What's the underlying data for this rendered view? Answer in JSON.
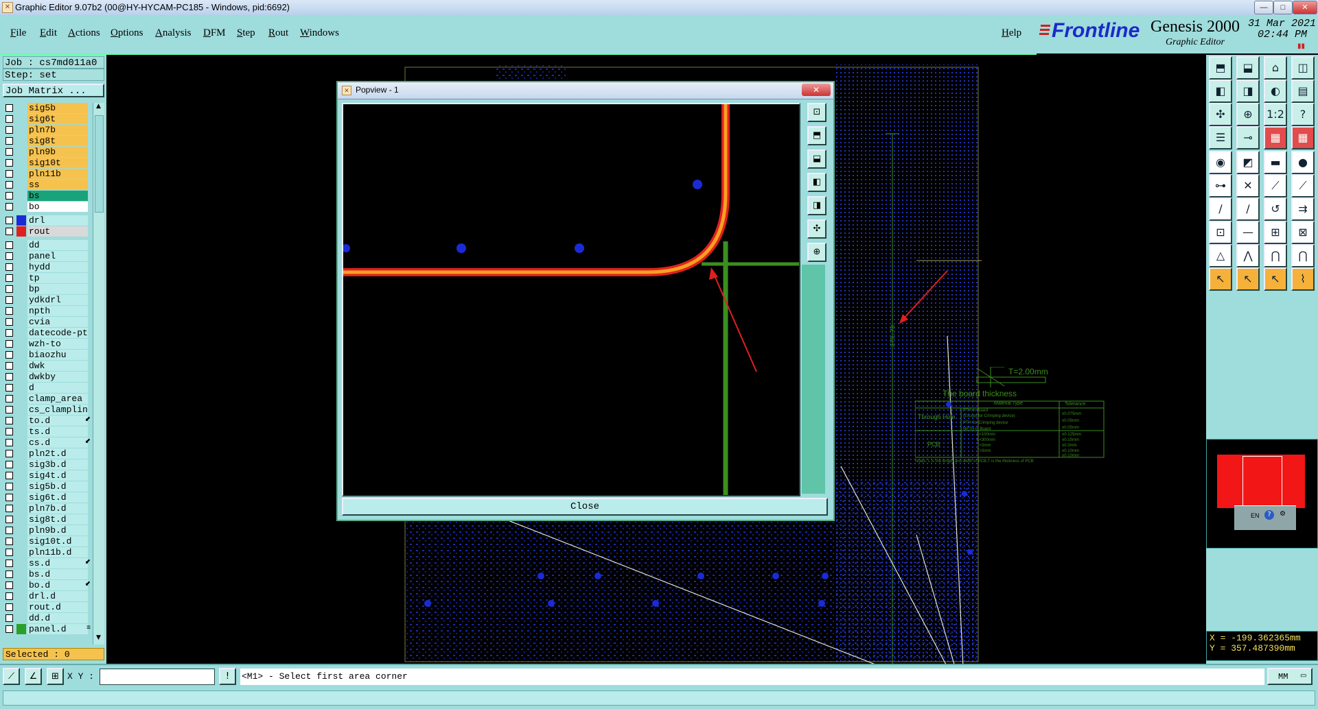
{
  "titlebar": {
    "title": "Graphic Editor 9.07b2 (00@HY-HYCAM-PC185 - Windows, pid:6692)"
  },
  "menu": {
    "items": [
      "File",
      "Edit",
      "Actions",
      "Options",
      "Analysis",
      "DFM",
      "Step",
      "Rout",
      "Windows"
    ],
    "help": "Help"
  },
  "brand": {
    "logo": "Frontline",
    "product": "Genesis 2000",
    "subtitle": "Graphic Editor",
    "date": "31 Mar 2021",
    "time": "02:44 PM"
  },
  "job": {
    "job_label": "Job : cs7md011a0",
    "step_label": "Step: set",
    "matrix_button": "Job Matrix ..."
  },
  "layers": [
    {
      "name": "sig5b",
      "color": "#f6c24e"
    },
    {
      "name": "sig6t",
      "color": "#f6c24e"
    },
    {
      "name": "pln7b",
      "color": "#f6c24e"
    },
    {
      "name": "sig8t",
      "color": "#f6c24e"
    },
    {
      "name": "pln9b",
      "color": "#f6c24e"
    },
    {
      "name": "sig10t",
      "color": "#f6c24e"
    },
    {
      "name": "pln11b",
      "color": "#f6c24e"
    },
    {
      "name": "ss",
      "color": "#f6c24e"
    },
    {
      "name": "bs",
      "color": "#19a37a"
    },
    {
      "name": "bo",
      "color": "#ffffff"
    },
    {
      "name": "drl",
      "color": "#b9ecea",
      "swatch": "#1a2bd6"
    },
    {
      "name": "rout",
      "color": "#d9d9d9",
      "swatch": "#e02020"
    },
    {
      "name": "dd",
      "color": "#b9ecea"
    },
    {
      "name": "panel",
      "color": "#b9ecea"
    },
    {
      "name": "hydd",
      "color": "#b9ecea"
    },
    {
      "name": "tp",
      "color": "#b9ecea"
    },
    {
      "name": "bp",
      "color": "#b9ecea"
    },
    {
      "name": "ydkdrl",
      "color": "#b9ecea"
    },
    {
      "name": "npth",
      "color": "#b9ecea"
    },
    {
      "name": "cvia",
      "color": "#b9ecea"
    },
    {
      "name": "datecode-pte",
      "color": "#b9ecea"
    },
    {
      "name": "wzh-to",
      "color": "#b9ecea"
    },
    {
      "name": "biaozhu",
      "color": "#b9ecea"
    },
    {
      "name": "dwk",
      "color": "#b9ecea"
    },
    {
      "name": "dwkby",
      "color": "#b9ecea"
    },
    {
      "name": "d",
      "color": "#b9ecea"
    },
    {
      "name": "clamp_area",
      "color": "#b9ecea"
    },
    {
      "name": "cs_clamplin",
      "color": "#b9ecea"
    },
    {
      "name": "to.d",
      "color": "#b9ecea",
      "mark": "⬋"
    },
    {
      "name": "ts.d",
      "color": "#b9ecea"
    },
    {
      "name": "cs.d",
      "color": "#b9ecea",
      "mark": "⬋"
    },
    {
      "name": "pln2t.d",
      "color": "#b9ecea"
    },
    {
      "name": "sig3b.d",
      "color": "#b9ecea"
    },
    {
      "name": "sig4t.d",
      "color": "#b9ecea"
    },
    {
      "name": "sig5b.d",
      "color": "#b9ecea"
    },
    {
      "name": "sig6t.d",
      "color": "#b9ecea"
    },
    {
      "name": "pln7b.d",
      "color": "#b9ecea"
    },
    {
      "name": "sig8t.d",
      "color": "#b9ecea"
    },
    {
      "name": "pln9b.d",
      "color": "#b9ecea"
    },
    {
      "name": "sig10t.d",
      "color": "#b9ecea"
    },
    {
      "name": "pln11b.d",
      "color": "#b9ecea"
    },
    {
      "name": "ss.d",
      "color": "#b9ecea",
      "mark": "⬋"
    },
    {
      "name": "bs.d",
      "color": "#b9ecea"
    },
    {
      "name": "bo.d",
      "color": "#b9ecea",
      "mark": "⬋"
    },
    {
      "name": "drl.d",
      "color": "#b9ecea"
    },
    {
      "name": "rout.d",
      "color": "#b9ecea"
    },
    {
      "name": "dd.d",
      "color": "#b9ecea"
    },
    {
      "name": "panel.d",
      "color": "#b9ecea",
      "swatch": "#2aa02a",
      "mark": "≡"
    }
  ],
  "selected_label": "Selected : 0",
  "popview": {
    "title": "Popview - 1",
    "close_label": "Close"
  },
  "canvas": {
    "dimension_text": "379.78",
    "note_t": "T=2.00mm",
    "note_board": "The board thickness",
    "table_header": [
      "Material Type",
      "Tolerance"
    ],
    "through_hole": "Through Hole",
    "pcb": "PCB",
    "rows": [
      [
        "PTH in Board",
        "±0.075mm"
      ],
      [
        "(Except for Crimping device)",
        "±0.05mm"
      ],
      [
        "PTH for Crimping device",
        "±0.05mm"
      ],
      [
        "NPTH in Board",
        "±0.125mm"
      ],
      [
        "L<100mm",
        "±0.15mm"
      ],
      [
        "L<300mm",
        "±0.3mm"
      ],
      [
        "T<3mm",
        "±0.10mm"
      ],
      [
        "T>3mm",
        "±0.10mm"
      ]
    ],
    "notes": "Notes: L is the length and width of PCB,T is the thickness of PCB"
  },
  "coords": {
    "x": "X = -199.362365mm",
    "y": "Y = 357.487390mm"
  },
  "status": {
    "xy_label": "X Y :",
    "message": "<M1> - Select first area corner",
    "units": "MM",
    "lang": "EN"
  },
  "colors": {
    "panel_bg": "#9fdcdc",
    "trace_red": "#e02020",
    "trace_orange": "#f6a21f",
    "cross_green": "#3b8f1e",
    "pad_blue": "#1a2bd6"
  }
}
